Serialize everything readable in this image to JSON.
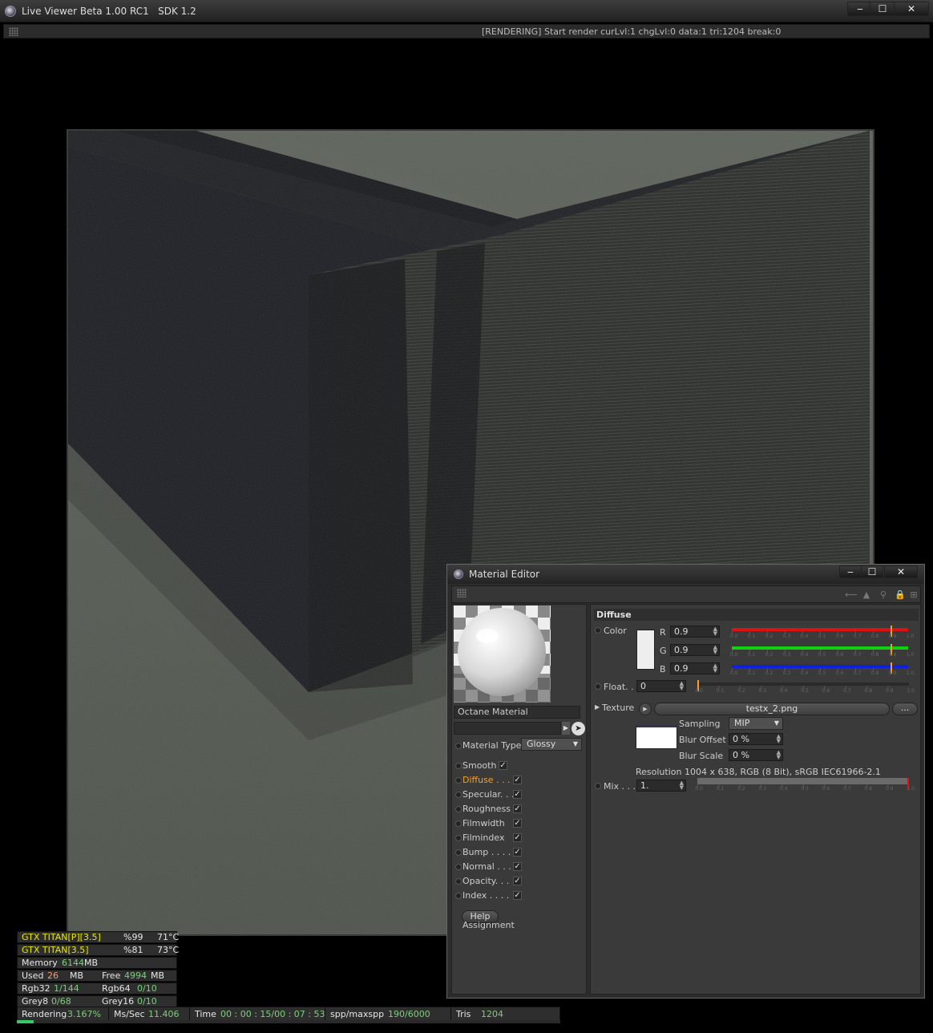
{
  "main_window": {
    "title": "Live Viewer Beta 1.00 RC1   SDK 1.2",
    "status": "[RENDERING] Start render curLvl:1 chgLvl:0 data:1 tri:1204 break:0",
    "buttons": {
      "minimize": "‒",
      "maximize": "☐",
      "close": "✕"
    }
  },
  "gpu_stats": {
    "gpus": [
      {
        "name": "GTX TITAN[P][3.5]",
        "usage": "%99",
        "temp": "71°C"
      },
      {
        "name": "GTX TITAN[3.5]",
        "usage": "%81",
        "temp": "73°C"
      }
    ],
    "memory": {
      "label": "Memory",
      "value": "6144",
      "unit": "MB"
    },
    "used": {
      "label": "Used",
      "value": "26",
      "unit": "MB"
    },
    "free": {
      "label": "Free",
      "value": "4994",
      "unit": "MB"
    },
    "rgb32": {
      "label": "Rgb32",
      "value": "1/144"
    },
    "rgb64": {
      "label": "Rgb64",
      "value": "0/10"
    },
    "grey8": {
      "label": "Grey8",
      "value": "0/68"
    },
    "grey16": {
      "label": "Grey16",
      "value": "0/10"
    }
  },
  "bottom_status": {
    "rendering_label": "Rendering",
    "rendering_value": "3.167%",
    "rendering_fraction": 0.03167,
    "ms_label": "Ms/Sec",
    "ms_value": "11.406",
    "time_label": "Time",
    "time_value": "00 : 00 : 15/00 : 07 : 53",
    "spp_label": "spp/maxspp",
    "spp_value": "190/6000",
    "tris_label": "Tris",
    "tris_value": "1204"
  },
  "material_editor": {
    "title": "Material Editor",
    "buttons": {
      "minimize": "‒",
      "maximize": "☐",
      "close": "✕"
    },
    "material_name": "Octane Material",
    "material_type_label": "Material Type",
    "material_type_value": "Glossy",
    "channels": [
      {
        "label": "Smooth",
        "checked": "✓"
      },
      {
        "label": "Diffuse . . .",
        "checked": "✓"
      },
      {
        "label": "Specular. . .",
        "checked": "✓"
      },
      {
        "label": "Roughness",
        "checked": "✓"
      },
      {
        "label": "Filmwidth",
        "checked": "✓"
      },
      {
        "label": "Filmindex",
        "checked": "✓"
      },
      {
        "label": "Bump . . . .",
        "checked": "✓"
      },
      {
        "label": "Normal . . .",
        "checked": "✓"
      },
      {
        "label": "Opacity. . .",
        "checked": "✓"
      },
      {
        "label": "Index . . . .",
        "checked": "✓"
      }
    ],
    "help_label": "Help",
    "assignment_label": "Assignment",
    "diffuse": {
      "header": "Diffuse",
      "color_label": "Color",
      "r_label": "R",
      "r_value": "0.9",
      "g_label": "G",
      "g_value": "0.9",
      "b_label": "B",
      "b_value": "0.9",
      "float_label": "Float. .",
      "float_value": "0",
      "texture_label": "Texture",
      "texture_file": "testx_2.png",
      "texture_more": "...",
      "sampling_label": "Sampling",
      "sampling_value": "MIP",
      "blur_offset_label": "Blur Offset",
      "blur_offset_value": "0 %",
      "blur_scale_label": "Blur Scale",
      "blur_scale_value": "0 %",
      "resolution_text": "Resolution 1004 x 638, RGB (8 Bit), sRGB IEC61966-2.1",
      "mix_label": "Mix . . .",
      "mix_value": "1.",
      "scale_ticks": [
        "0.0",
        "0.1",
        "0.2",
        "0.3",
        "0.4",
        "0.5",
        "0.6",
        "0.7",
        "0.8",
        "0.9",
        "1.0"
      ],
      "colors": {
        "r": "#e01010",
        "g": "#10d010",
        "b": "#1020e0",
        "handle": "#f0a030"
      }
    }
  }
}
